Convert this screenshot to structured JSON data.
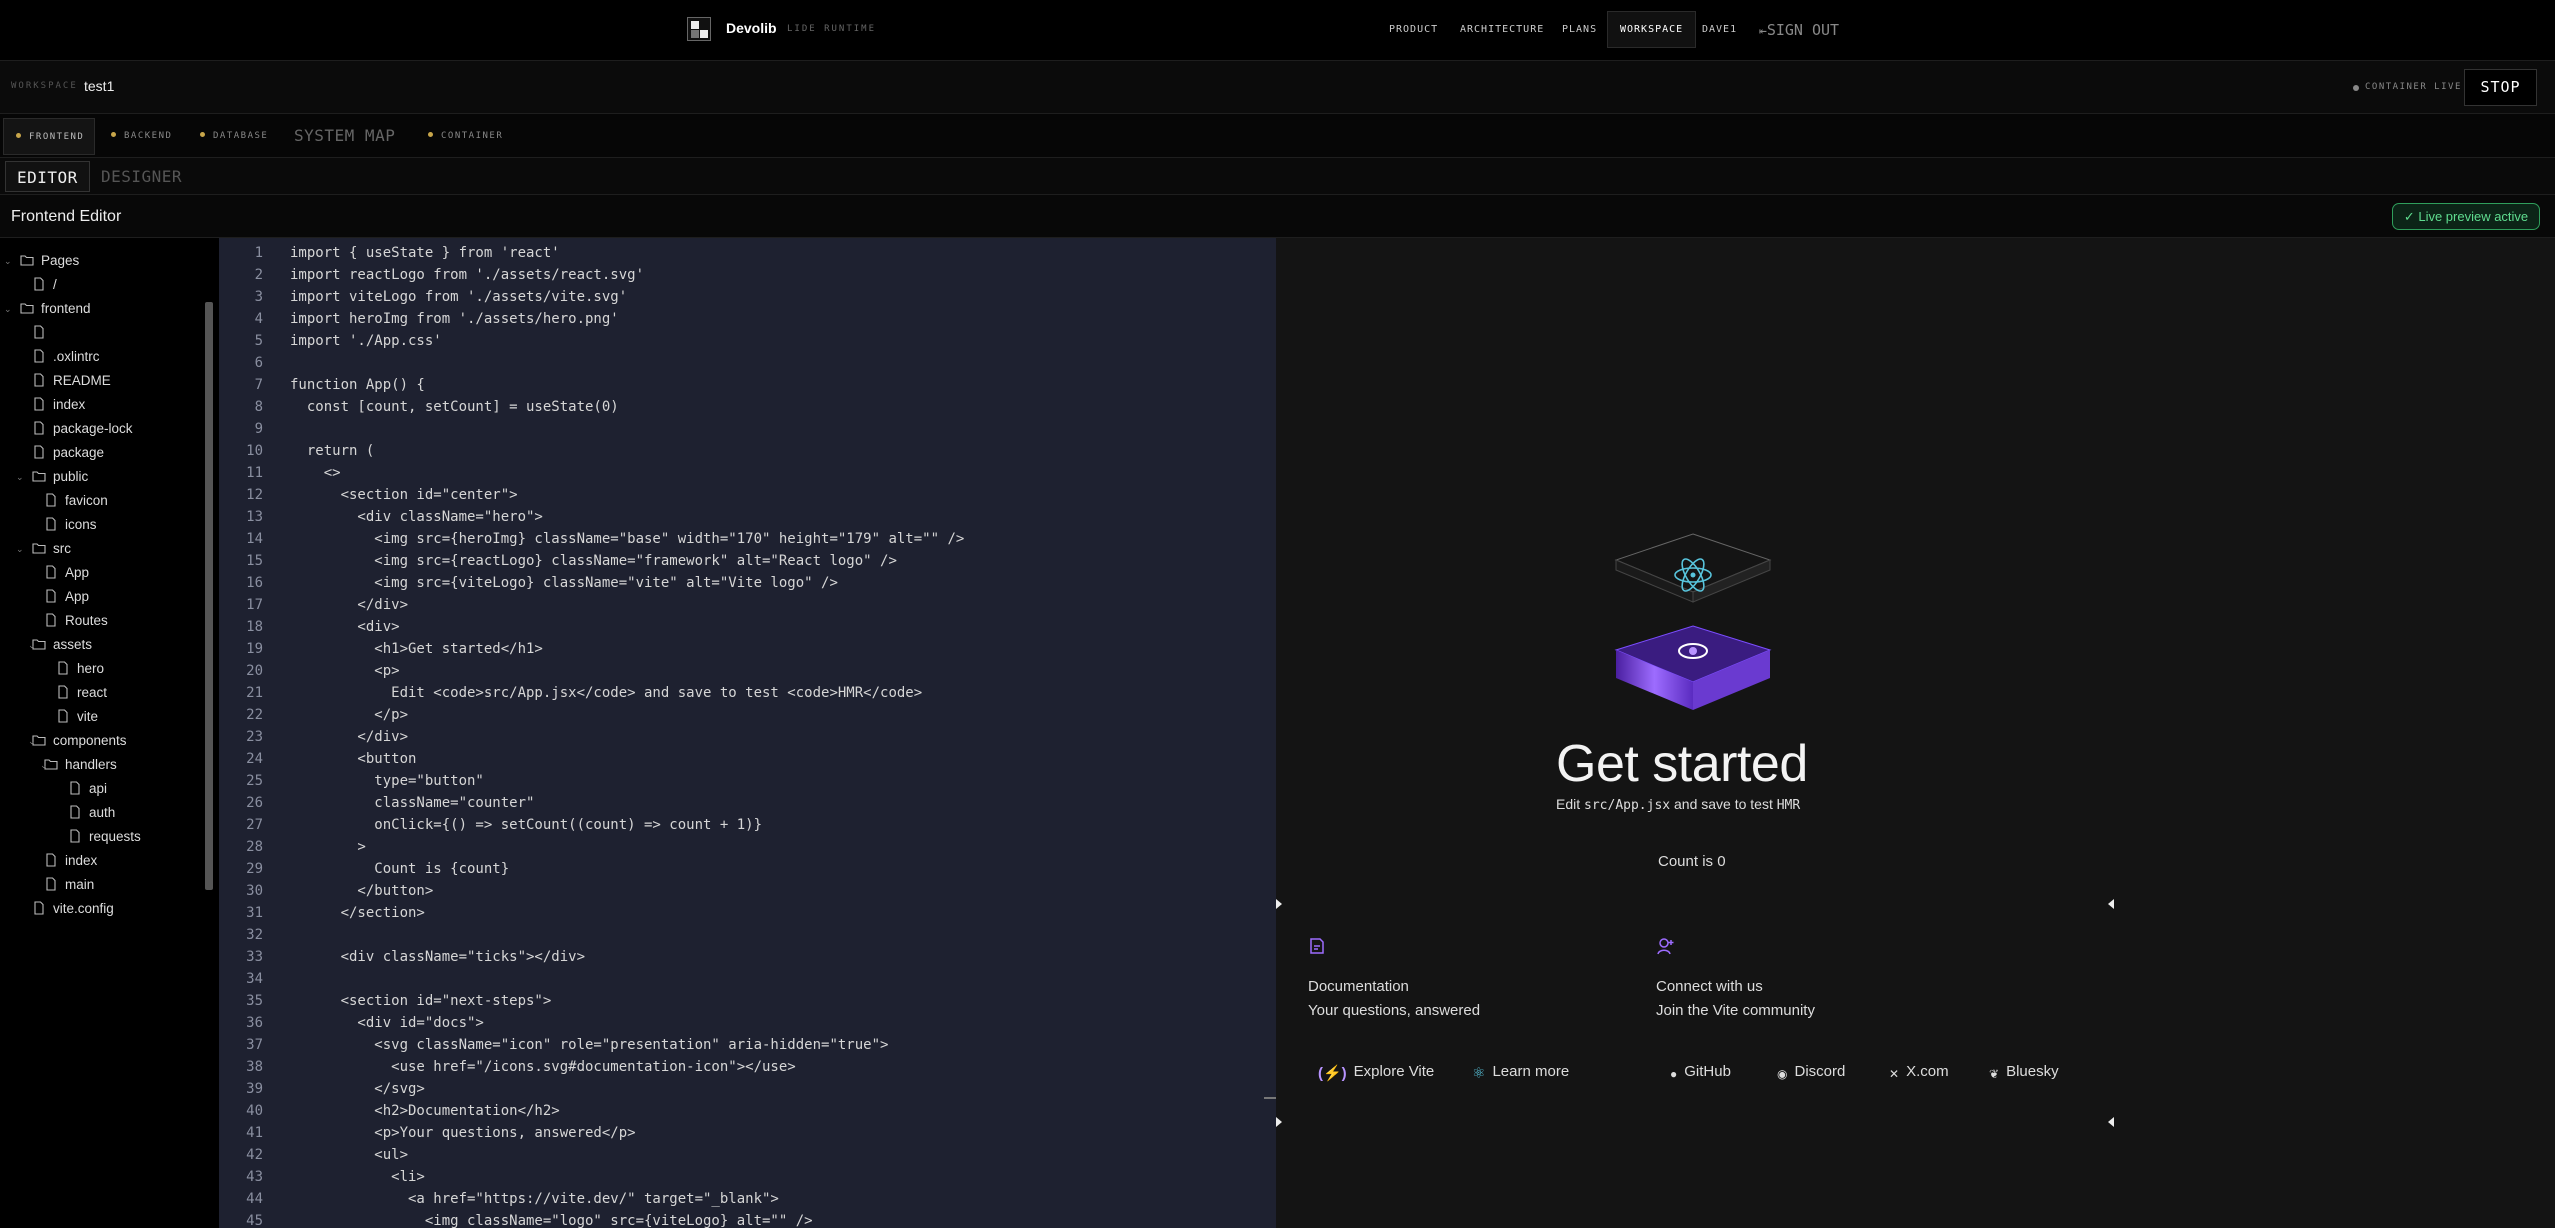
{
  "nav": {
    "brand": "Devolib",
    "brand_sub": "LIDE RUNTIME",
    "links": [
      "PRODUCT",
      "ARCHITECTURE",
      "PLANS",
      "WORKSPACE",
      "DAVE1"
    ],
    "sign_out": "SIGN OUT"
  },
  "workspace": {
    "label": "WORKSPACE",
    "name": "test1",
    "status": "CONTAINER LIVE",
    "stop": "STOP"
  },
  "service_tabs": [
    "FRONTEND",
    "BACKEND",
    "DATABASE",
    "SYSTEM MAP",
    "CONTAINER"
  ],
  "modes": [
    "EDITOR",
    "DESIGNER"
  ],
  "editor": {
    "title": "Frontend Editor",
    "preview_badge": "✓ Live preview active"
  },
  "tree": [
    {
      "label": "Pages",
      "type": "folder"
    },
    {
      "label": "/",
      "type": "file"
    },
    {
      "label": "frontend",
      "type": "folder"
    },
    {
      "label": "",
      "type": "file"
    },
    {
      "label": ".oxlintrc",
      "type": "file"
    },
    {
      "label": "README",
      "type": "file"
    },
    {
      "label": "index",
      "type": "file"
    },
    {
      "label": "package-lock",
      "type": "file"
    },
    {
      "label": "package",
      "type": "file"
    },
    {
      "label": "public",
      "type": "folder"
    },
    {
      "label": "favicon",
      "type": "file"
    },
    {
      "label": "icons",
      "type": "file"
    },
    {
      "label": "src",
      "type": "folder"
    },
    {
      "label": "App",
      "type": "file"
    },
    {
      "label": "App",
      "type": "file"
    },
    {
      "label": "Routes",
      "type": "file"
    },
    {
      "label": "assets",
      "type": "folder"
    },
    {
      "label": "hero",
      "type": "file"
    },
    {
      "label": "react",
      "type": "file"
    },
    {
      "label": "vite",
      "type": "file"
    },
    {
      "label": "components",
      "type": "folder"
    },
    {
      "label": "handlers",
      "type": "folder"
    },
    {
      "label": "api",
      "type": "file"
    },
    {
      "label": "auth",
      "type": "file"
    },
    {
      "label": "requests",
      "type": "file"
    },
    {
      "label": "index",
      "type": "file"
    },
    {
      "label": "main",
      "type": "file"
    },
    {
      "label": "vite.config",
      "type": "file"
    }
  ],
  "code": [
    "import { useState } from 'react'",
    "import reactLogo from './assets/react.svg'",
    "import viteLogo from './assets/vite.svg'",
    "import heroImg from './assets/hero.png'",
    "import './App.css'",
    "",
    "function App() {",
    "  const [count, setCount] = useState(0)",
    "",
    "  return (",
    "    <>",
    "      <section id=\"center\">",
    "        <div className=\"hero\">",
    "          <img src={heroImg} className=\"base\" width=\"170\" height=\"179\" alt=\"\" />",
    "          <img src={reactLogo} className=\"framework\" alt=\"React logo\" />",
    "          <img src={viteLogo} className=\"vite\" alt=\"Vite logo\" />",
    "        </div>",
    "        <div>",
    "          <h1>Get started</h1>",
    "          <p>",
    "            Edit <code>src/App.jsx</code> and save to test <code>HMR</code>",
    "          </p>",
    "        </div>",
    "        <button",
    "          type=\"button\"",
    "          className=\"counter\"",
    "          onClick={() => setCount((count) => count + 1)}",
    "        >",
    "          Count is {count}",
    "        </button>",
    "      </section>",
    "",
    "      <div className=\"ticks\"></div>",
    "",
    "      <section id=\"next-steps\">",
    "        <div id=\"docs\">",
    "          <svg className=\"icon\" role=\"presentation\" aria-hidden=\"true\">",
    "            <use href=\"/icons.svg#documentation-icon\"></use>",
    "          </svg>",
    "          <h2>Documentation</h2>",
    "          <p>Your questions, answered</p>",
    "          <ul>",
    "            <li>",
    "              <a href=\"https://vite.dev/\" target=\"_blank\">",
    "                <img className=\"logo\" src={viteLogo} alt=\"\" />"
  ],
  "preview": {
    "title": "Get started",
    "sub_edit": "Edit",
    "sub_file": "src/App.jsx",
    "sub_mid": "and save to test",
    "sub_hmr": "HMR",
    "count": "Count is 0",
    "docs_title": "Documentation",
    "docs_sub": "Your questions, answered",
    "social_title": "Connect with us",
    "social_sub": "Join the Vite community",
    "links": [
      "Explore Vite",
      "Learn more",
      "GitHub",
      "Discord",
      "X.com",
      "Bluesky"
    ]
  },
  "colors": {
    "accent_green": "#2f9e5b",
    "code_bg": "#1e2130",
    "vite_purple": "#8f5cff",
    "react_blue": "#58c4dc"
  }
}
